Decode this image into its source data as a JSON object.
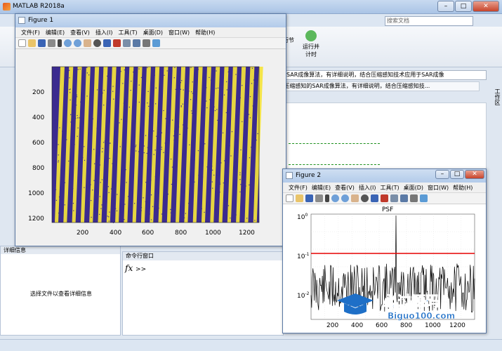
{
  "matlab": {
    "title": "MATLAB R2018a",
    "search_placeholder": "搜索文档",
    "ribbon_run_label": "运行并\n计时",
    "ribbon_run_section": "行节",
    "address_bar": "SAR成像算法，有详细说明，结合压缩感知技术应用于SAR成像",
    "path_bar": "ktop\\基于压缩感知的SAR成像算法，有详细说明，结合压缩感知技...",
    "side_tab": "工作区",
    "details_header": "详细信息",
    "details_message": "选择文件以查看详细信息",
    "command_header": "命令行窗口",
    "command_prompt": ">>",
    "fx_symbol": "fx",
    "colors": {
      "titlebar": "#aac4e6",
      "figure_bg": "#3b2b8f",
      "stripe": "#f5e43b",
      "psf_red": "#e60000"
    }
  },
  "figure1": {
    "title": "Figure 1",
    "menu": [
      "文件(F)",
      "编辑(E)",
      "查看(V)",
      "插入(I)",
      "工具(T)",
      "桌面(D)",
      "窗口(W)",
      "帮助(H)"
    ],
    "yticks": [
      "200",
      "400",
      "600",
      "800",
      "1000",
      "1200"
    ],
    "xticks": [
      "200",
      "400",
      "600",
      "800",
      "1000",
      "1200"
    ]
  },
  "figure2": {
    "title": "Figure 2",
    "menu": [
      "文件(F)",
      "编辑(E)",
      "查看(V)",
      "插入(I)",
      "工具(T)",
      "桌面(D)",
      "窗口(W)",
      "帮助(H)"
    ],
    "plot_title": "PSF",
    "ytick_base": "10",
    "yticks_exp": [
      "0",
      "-1",
      "-2"
    ],
    "xticks": [
      "200",
      "400",
      "600",
      "800",
      "1000",
      "1200"
    ]
  },
  "watermark": {
    "brand": "必过源码",
    "url": "Biguo100.com"
  },
  "window_buttons": {
    "minimize": "–",
    "maximize": "□",
    "close": "✕"
  }
}
